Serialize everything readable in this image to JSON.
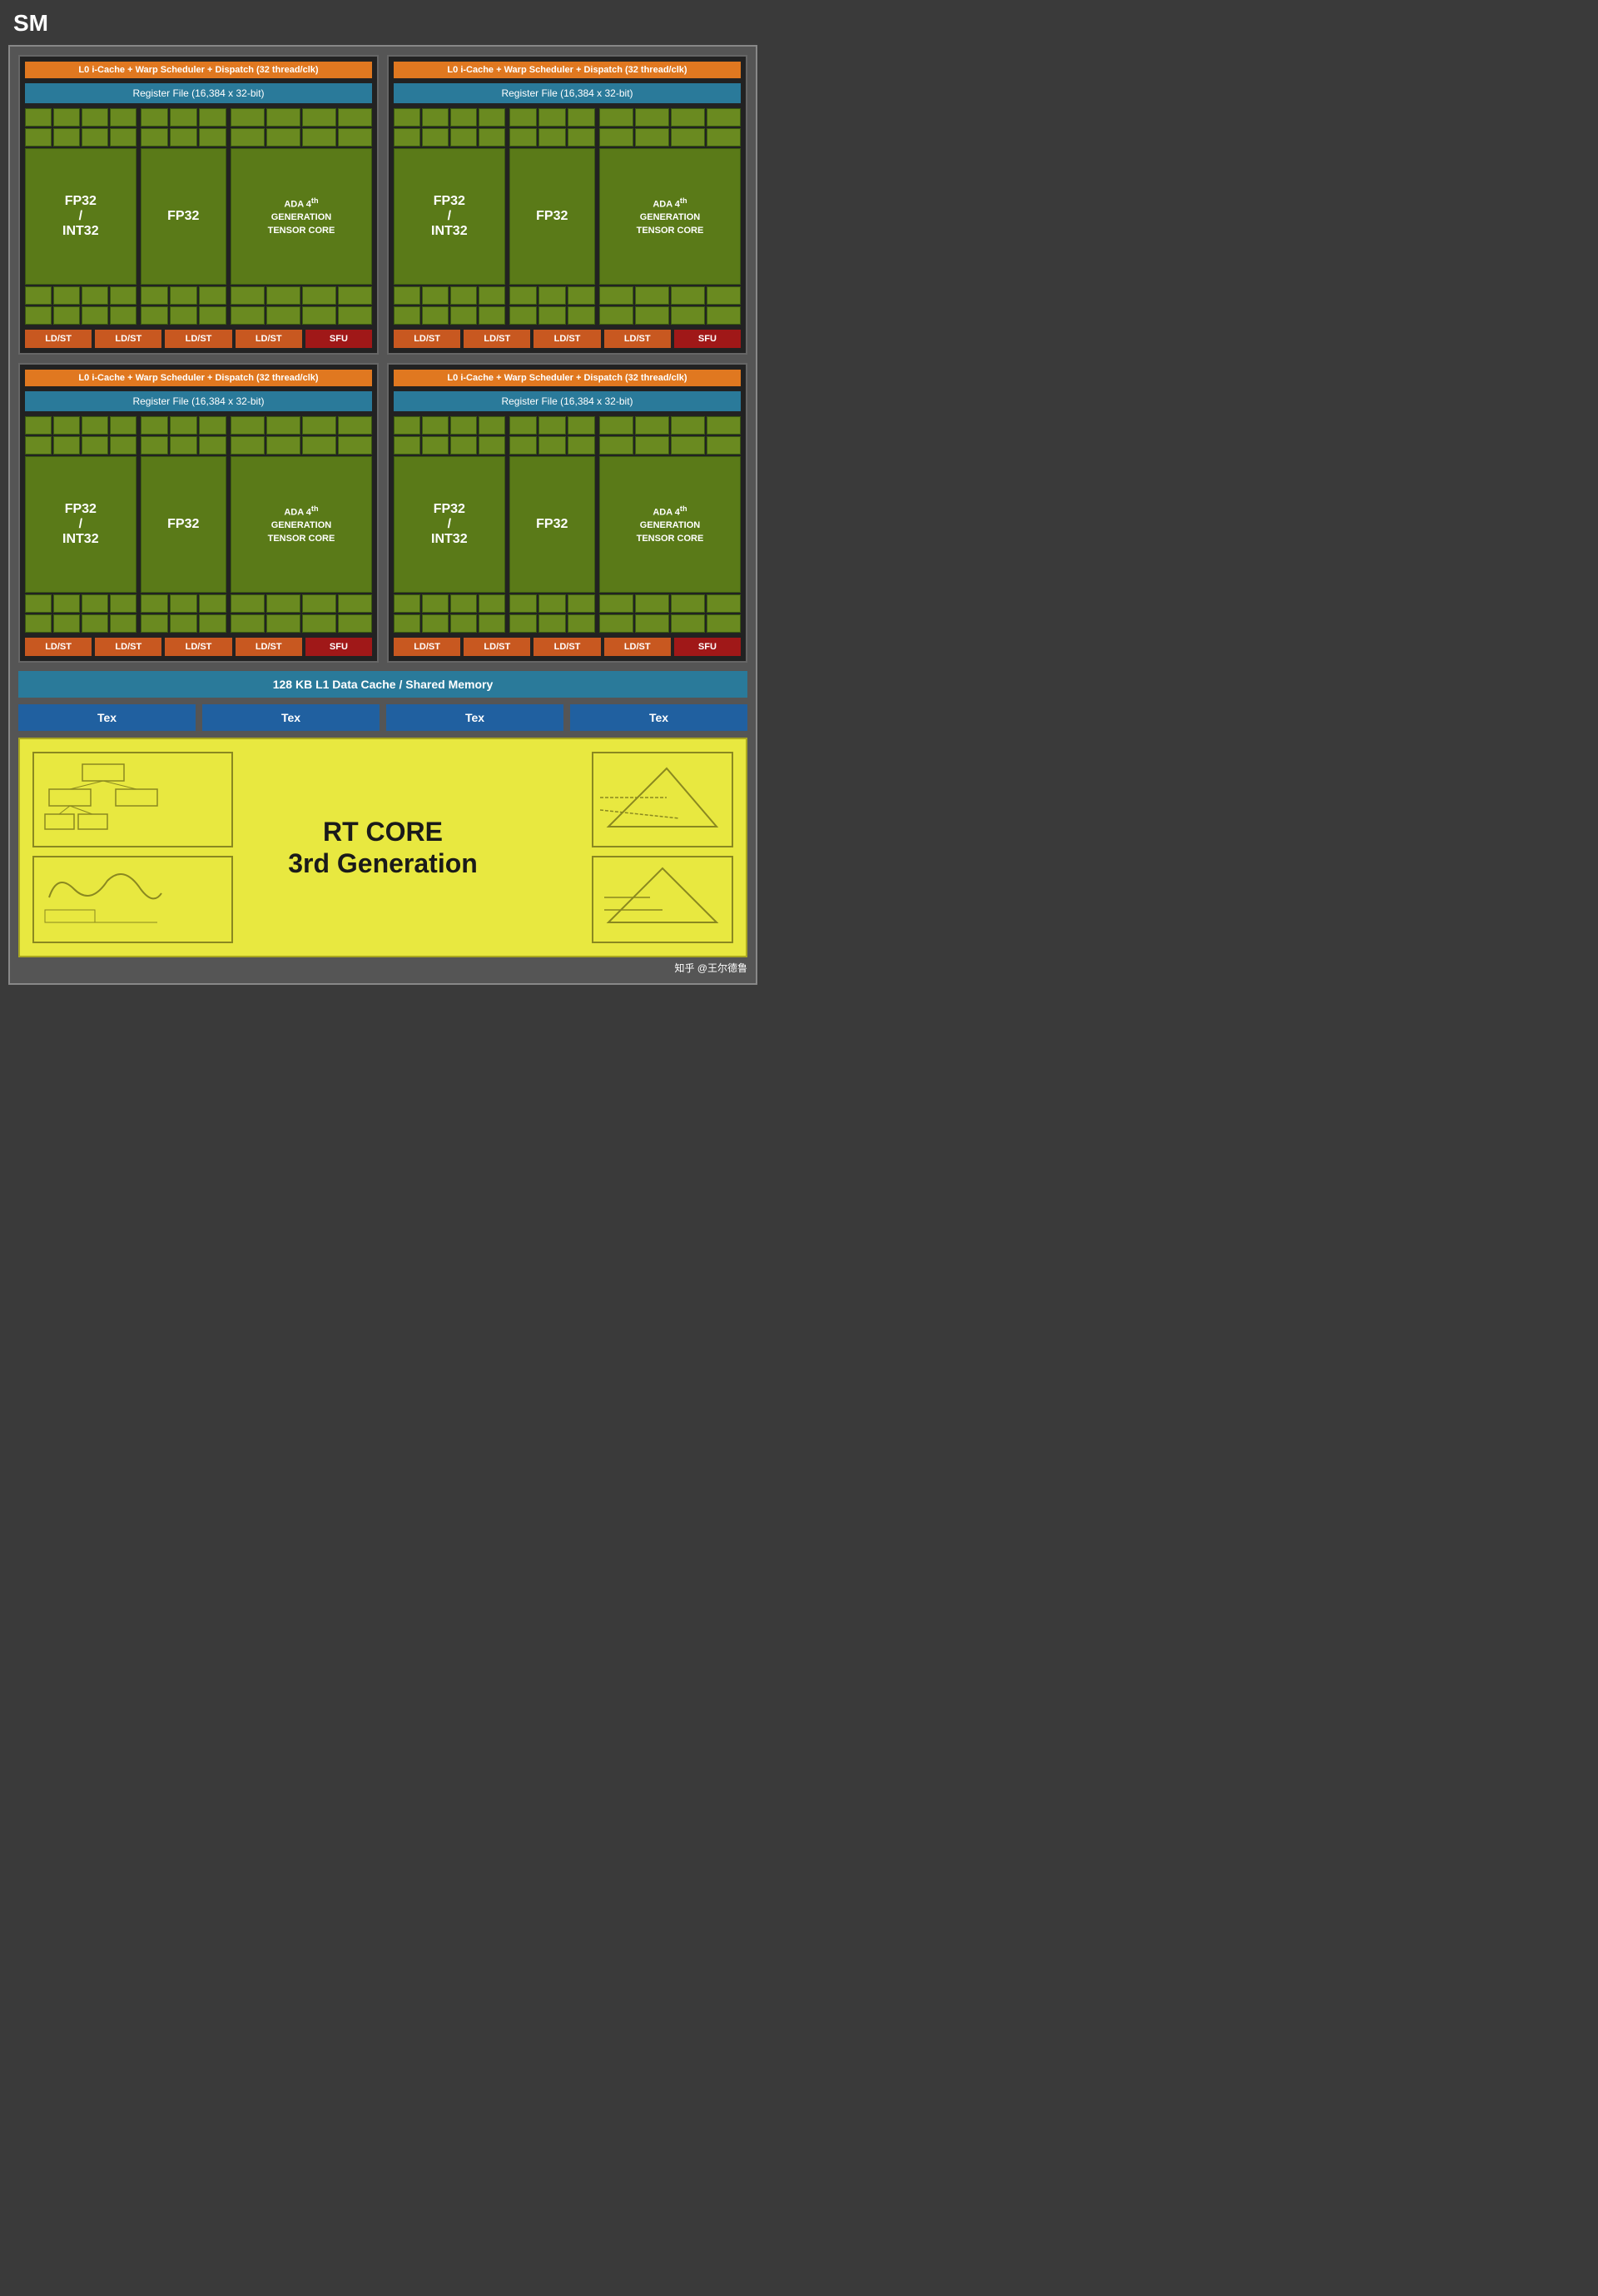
{
  "title": "SM",
  "subunits": [
    {
      "warpScheduler": "L0 i-Cache + Warp Scheduler + Dispatch (32 thread/clk)",
      "registerFile": "Register File (16,384 x 32-bit)",
      "fp32int32Label": "FP32\n/\nINT32",
      "fp32Label": "FP32",
      "tensorLabel": "ADA 4th GENERATION TENSOR CORE",
      "ldstLabels": [
        "LD/ST",
        "LD/ST",
        "LD/ST",
        "LD/ST"
      ],
      "sfuLabel": "SFU"
    },
    {
      "warpScheduler": "L0 i-Cache + Warp Scheduler + Dispatch (32 thread/clk)",
      "registerFile": "Register File (16,384 x 32-bit)",
      "fp32int32Label": "FP32\n/\nINT32",
      "fp32Label": "FP32",
      "tensorLabel": "ADA 4th GENERATION TENSOR CORE",
      "ldstLabels": [
        "LD/ST",
        "LD/ST",
        "LD/ST",
        "LD/ST"
      ],
      "sfuLabel": "SFU"
    },
    {
      "warpScheduler": "L0 i-Cache + Warp Scheduler + Dispatch (32 thread/clk)",
      "registerFile": "Register File (16,384 x 32-bit)",
      "fp32int32Label": "FP32\n/\nINT32",
      "fp32Label": "FP32",
      "tensorLabel": "ADA 4th GENERATION TENSOR CORE",
      "ldstLabels": [
        "LD/ST",
        "LD/ST",
        "LD/ST",
        "LD/ST"
      ],
      "sfuLabel": "SFU"
    },
    {
      "warpScheduler": "L0 i-Cache + Warp Scheduler + Dispatch (32 thread/clk)",
      "registerFile": "Register File (16,384 x 32-bit)",
      "fp32int32Label": "FP32\n/\nINT32",
      "fp32Label": "FP32",
      "tensorLabel": "ADA 4th GENERATION TENSOR CORE",
      "ldstLabels": [
        "LD/ST",
        "LD/ST",
        "LD/ST",
        "LD/ST"
      ],
      "sfuLabel": "SFU"
    }
  ],
  "l1Cache": "128 KB L1 Data Cache / Shared Memory",
  "texLabels": [
    "Tex",
    "Tex",
    "Tex",
    "Tex"
  ],
  "rtCore": {
    "title": "RT CORE",
    "subtitle": "3rd Generation"
  },
  "watermark": "知乎 @王尔德鲁"
}
